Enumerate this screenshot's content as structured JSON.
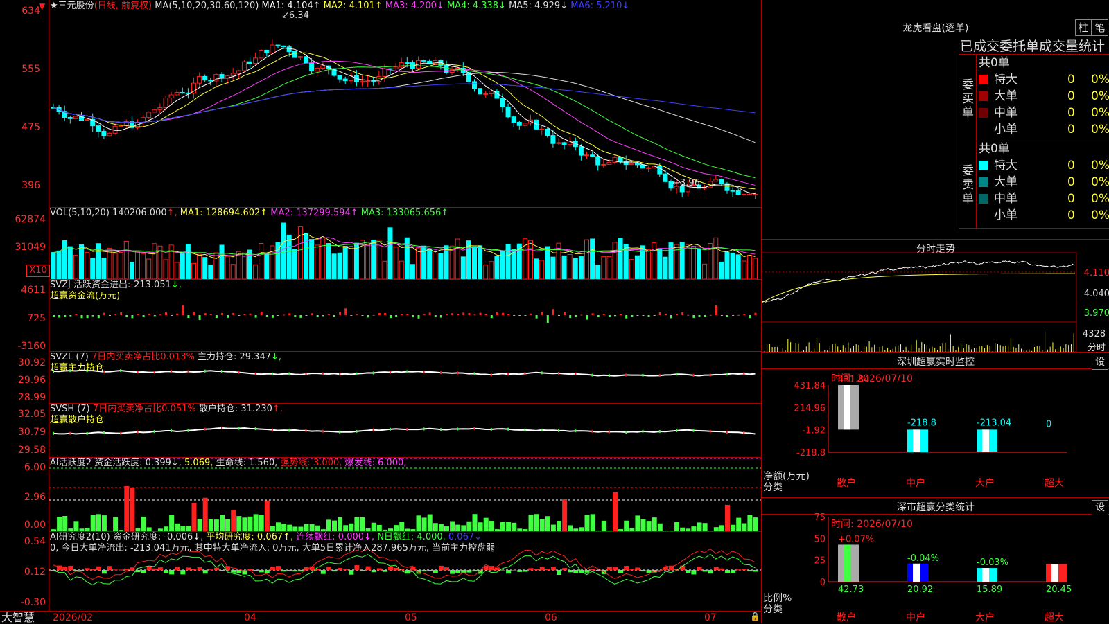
{
  "stock": {
    "name": "★三元股份",
    "period": "(日线, 前复权)"
  },
  "main": {
    "ma_header": "MA(5,10,20,30,60,120)",
    "ma": [
      {
        "label": "MA1:",
        "value": "4.104",
        "arrow": "↑",
        "color": "#ffffff"
      },
      {
        "label": "MA2:",
        "value": "4.101",
        "arrow": "↑",
        "color": "#ffff40"
      },
      {
        "label": "MA3:",
        "value": "4.200",
        "arrow": "↓",
        "color": "#ff40ff"
      },
      {
        "label": "MA4:",
        "value": "4.338",
        "arrow": "↓",
        "color": "#40ff40"
      },
      {
        "label": "MA5:",
        "value": "4.929",
        "arrow": "↓",
        "color": "#dddddd"
      },
      {
        "label": "MA6:",
        "value": "5.210",
        "arrow": "↓",
        "color": "#4040ff"
      }
    ],
    "ticks": [
      "634",
      "555",
      "475",
      "396"
    ],
    "high_label": "6.34",
    "low_label": "←3.96",
    "ylim": [
      3.8,
      6.4
    ]
  },
  "vol": {
    "header": "VOL(5,10,20)",
    "value": "140206.000",
    "ma": [
      {
        "label": "MA1:",
        "value": "128694.602",
        "arrow": "↑",
        "color": "#ffff40"
      },
      {
        "label": "MA2:",
        "value": "137299.594",
        "arrow": "↑",
        "color": "#ff40ff"
      },
      {
        "label": "MA3:",
        "value": "133065.656",
        "arrow": "↑",
        "color": "#40ff40"
      }
    ],
    "ticks": [
      "62874",
      "31049"
    ],
    "unit": "X10"
  },
  "svzj": {
    "header": "SVZJ  活跃资金进出:",
    "value": "-213.051",
    "arrow": "↓,",
    "sub": "超赢资金流(万元)",
    "ticks": [
      "4611",
      "725",
      "-3160"
    ]
  },
  "svzl": {
    "header": "SVZL (7)",
    "ratio": "7日内买卖净占比0.013%",
    "label": "主力持仓:",
    "value": "29.347",
    "arrow": "↓,",
    "sub": "超赢主力持仓",
    "ticks": [
      "30.92",
      "29.96",
      "28.99"
    ]
  },
  "svsh": {
    "header": "SVSH (7)",
    "ratio": "7日内买卖净占比0.051%",
    "label": "散户持仓:",
    "value": "31.230",
    "arrow": "↑,",
    "sub": "超赢散户持仓",
    "ticks": [
      "32.05",
      "30.79",
      "29.58"
    ]
  },
  "ai_active": {
    "header": "AI活跃度2",
    "items": [
      {
        "text": "资金活跃度: 0.399",
        "arrow": "↓,",
        "color": "#dddddd"
      },
      {
        "text": "5.069,",
        "arrow": "",
        "color": "#ffff40"
      },
      {
        "text": "生命线: 1.560,",
        "arrow": "",
        "color": "#dddddd"
      },
      {
        "text": "强势线: 3.000,",
        "arrow": "",
        "color": "#ff2020"
      },
      {
        "text": "爆发线: 6.000,",
        "arrow": "",
        "color": "#ff40ff"
      }
    ],
    "ticks": [
      "6.00",
      "2.96",
      "0.00"
    ]
  },
  "ai_research": {
    "header": "AI研究度2(10)",
    "items": [
      {
        "text": "资金研究度: -0.006",
        "arrow": "↓,",
        "color": "#dddddd"
      },
      {
        "text": "平均研究度: 0.067",
        "arrow": "↑,",
        "color": "#ffff40"
      },
      {
        "text": "连续飘红: 0.000",
        "arrow": "↓,",
        "color": "#ff40ff"
      },
      {
        "text": "N日飘红: 4.000,",
        "arrow": "",
        "color": "#40ff40"
      },
      {
        "text": "0.067",
        "arrow": "↓",
        "color": "#4040ff"
      }
    ],
    "note": "0, 今日大单净流出: -213.041万元, 其中特大单净流入: 0万元, 大单5日累计净入287.965万元, 当前主力控盘弱",
    "ticks": [
      "0.54",
      "0.12",
      "-0.30"
    ]
  },
  "xaxis": {
    "brand": "大智慧",
    "labels": [
      "2026/02",
      "04",
      "05",
      "06",
      "07"
    ]
  },
  "dragon": {
    "title": "龙虎看盘(逐单)",
    "btn1": "柱",
    "btn2": "笔",
    "subtitle": "已成交委托单成交量统计",
    "buy_label": "委买单",
    "sell_label": "委卖单",
    "buy_total": "共0单",
    "sell_total": "共0单",
    "buy_rows": [
      {
        "name": "特大",
        "color": "#ff0000",
        "count": "0",
        "pct": "0%"
      },
      {
        "name": "大单",
        "color": "#a00000",
        "count": "0",
        "pct": "0%"
      },
      {
        "name": "中单",
        "color": "#700000",
        "count": "0",
        "pct": "0%"
      },
      {
        "name": "小单",
        "color": "#000000",
        "count": "0",
        "pct": "0%"
      }
    ],
    "sell_rows": [
      {
        "name": "特大",
        "color": "#00ffff",
        "count": "0",
        "pct": "0%"
      },
      {
        "name": "大单",
        "color": "#008888",
        "count": "0",
        "pct": "0%"
      },
      {
        "name": "中单",
        "color": "#006666",
        "count": "0",
        "pct": "0%"
      },
      {
        "name": "小单",
        "color": "#000000",
        "count": "0",
        "pct": "0%"
      }
    ]
  },
  "intraday": {
    "title": "分时走势",
    "ticks": [
      "4.110",
      "4.040",
      "3.970"
    ],
    "vol": "4328",
    "vol_unit": "分时"
  },
  "monitor": {
    "title": "深圳超赢实时监控",
    "set": "设",
    "time": "时间: 2026/07/10",
    "ylabel": "净额(万元)",
    "xlabel": "分类",
    "ticks": [
      "431.84",
      "214.96",
      "-1.92",
      "-218.8"
    ],
    "chart_data": {
      "type": "bar",
      "categories": [
        "散户",
        "中户",
        "大户",
        "超大"
      ],
      "values": [
        431.84,
        -218.8,
        -213.04,
        0
      ],
      "labels": [
        "431.84",
        "-218.8",
        "-213.04",
        "0"
      ],
      "ylim": [
        -218.8,
        431.84
      ]
    }
  },
  "classify": {
    "title": "深市超赢分类统计",
    "set": "设",
    "time": "时间: 2026/07/10",
    "ylabel": "比例%",
    "xlabel": "分类",
    "ticks": [
      "75",
      "50",
      "25",
      "0"
    ],
    "chart_data": {
      "type": "bar",
      "categories": [
        "散户",
        "中户",
        "大户",
        "超大"
      ],
      "values": [
        42.73,
        20.92,
        15.89,
        20.45
      ],
      "changes": [
        "+0.07%",
        "-0.04%",
        "-0.03%",
        ""
      ],
      "value_labels": [
        "42.73",
        "20.92",
        "15.89",
        "20.45"
      ],
      "ylim": [
        0,
        75
      ]
    }
  }
}
